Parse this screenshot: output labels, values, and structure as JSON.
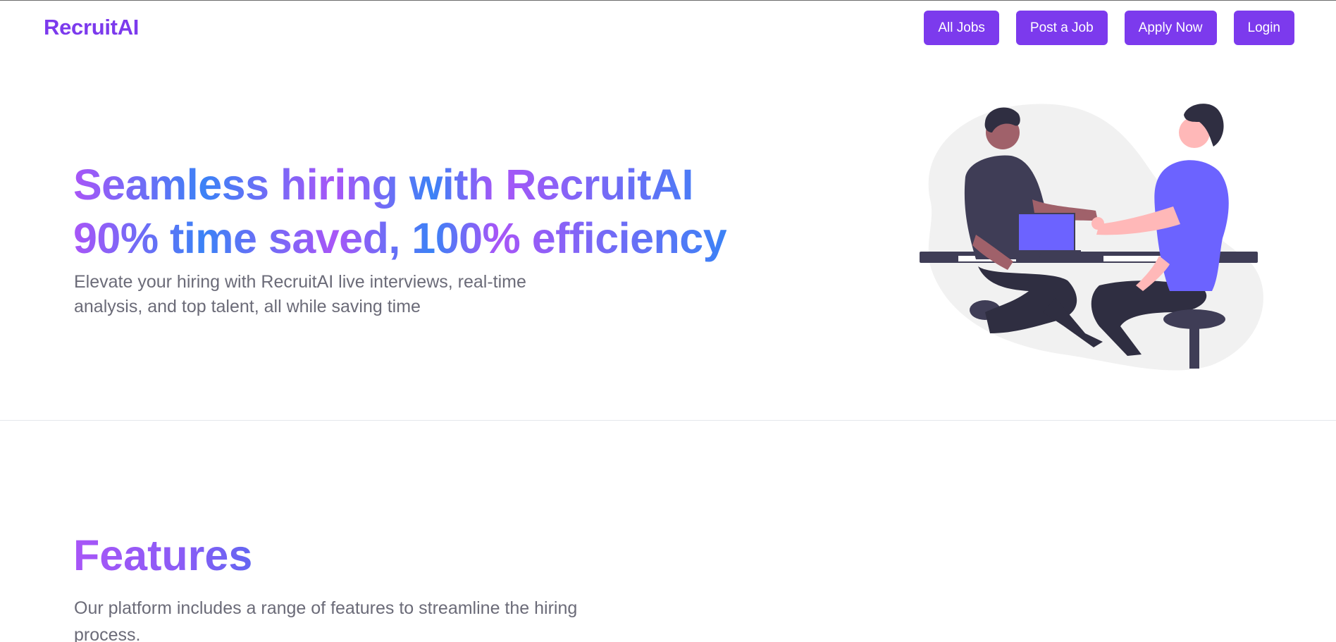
{
  "brand": {
    "name": "RecruitAI",
    "color": "#7c3aed"
  },
  "nav": {
    "buttons": [
      {
        "label": "All Jobs"
      },
      {
        "label": "Post a Job"
      },
      {
        "label": "Apply Now"
      },
      {
        "label": "Login"
      }
    ],
    "button_color": "#7c3aed"
  },
  "hero": {
    "title_line1": "Seamless hiring with RecruitAI",
    "title_line2": "90% time saved, 100% efficiency",
    "subtitle": "Elevate your hiring with RecruitAI live interviews, real-time analysis, and top talent, all while saving time",
    "illustration": "handshake-interview-illustration",
    "gradient_colors": [
      "#a855f7",
      "#3b82f6"
    ]
  },
  "features": {
    "title": "Features",
    "subtitle": "Our platform includes a range of features to streamline the hiring process."
  }
}
